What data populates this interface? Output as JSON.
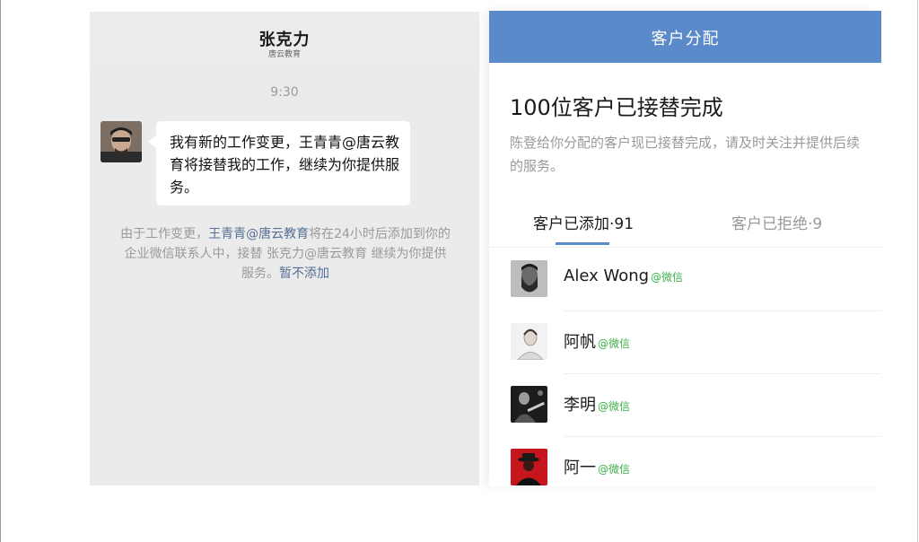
{
  "chat": {
    "contact_name": "张克力",
    "contact_org": "唐云教育",
    "time": "9:30",
    "message": "我有新的工作变更，王青青@唐云教育将接替我的工作，继续为你提供服务。",
    "notice_prefix": "由于工作变更，",
    "notice_link_name": "王青青@唐云教育",
    "notice_middle": "将在24小时后添加到你的企业微信联系人中，接替 张克力@唐云教育 继续为你提供服务。",
    "notice_action": "暂不添加"
  },
  "assign": {
    "title": "客户分配",
    "heading": "100位客户已接替完成",
    "description": "陈登给你分配的客户现已接替完成，请及时关注并提供后续的服务。",
    "tabs": [
      {
        "label": "客户已添加·91",
        "active": true
      },
      {
        "label": "客户已拒绝·9",
        "active": false
      }
    ],
    "customers": [
      {
        "name": "Alex Wong",
        "tag": "@微信",
        "avatar": "bearded-man-portrait"
      },
      {
        "name": "阿帆",
        "tag": "@微信",
        "avatar": "man-sketch-portrait"
      },
      {
        "name": "李明",
        "tag": "@微信",
        "avatar": "guitar-player-photo"
      },
      {
        "name": "阿一",
        "tag": "@微信",
        "avatar": "red-hat-figure"
      }
    ]
  },
  "colors": {
    "accent": "#5a8ac9",
    "wechat_tag": "#3cb04a",
    "link": "#566f97"
  }
}
